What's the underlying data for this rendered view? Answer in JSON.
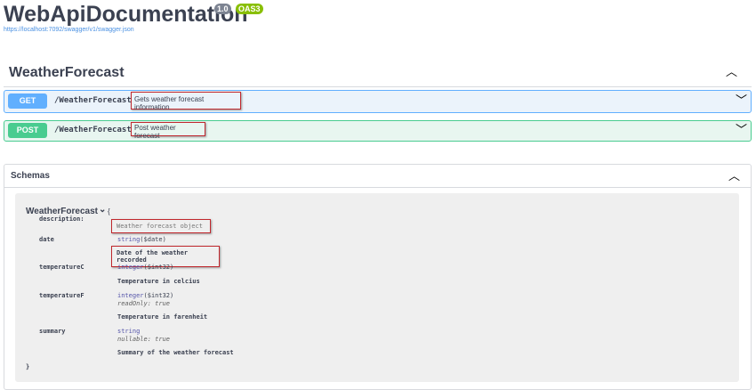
{
  "header": {
    "title": "WebApiDocumentation",
    "version": "1.0",
    "oas": "OAS3",
    "url": "https://localhost:7092/swagger/v1/swagger.json"
  },
  "tag": {
    "name": "WeatherForecast"
  },
  "operations": [
    {
      "method": "GET",
      "path": "/WeatherForecast",
      "summary": "Gets weather forecast information"
    },
    {
      "method": "POST",
      "path": "/WeatherForecast",
      "summary": "Post weather forecast"
    }
  ],
  "schemas": {
    "title": "Schemas",
    "model": {
      "name": "WeatherForecast",
      "open_brace": "{",
      "close_brace": "}",
      "description_label": "description:",
      "description": "Weather forecast object",
      "props": [
        {
          "name": "date",
          "type": "string",
          "format": "($date)",
          "description": "Date of the weather recorded"
        },
        {
          "name": "temperatureC",
          "type": "integer",
          "format": "($int32)",
          "description": "Temperature in celcius"
        },
        {
          "name": "temperatureF",
          "type": "integer",
          "format": "($int32)",
          "extra": "readOnly: true",
          "description": "Temperature in farenheit"
        },
        {
          "name": "summary",
          "type": "string",
          "format": "",
          "extra": "nullable: true",
          "description": "Summary of the weather forecast"
        }
      ]
    }
  },
  "colors": {
    "get": "#61affe",
    "post": "#49cc90",
    "highlight": "#c0272d"
  }
}
